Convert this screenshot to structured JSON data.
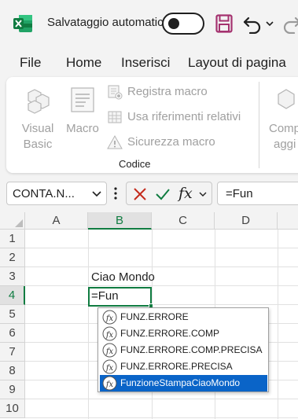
{
  "titlebar": {
    "autosave_label": "Salvataggio automatico",
    "autosave_on": false,
    "app_color": "#107c41",
    "save_color": "#a4326f"
  },
  "tabs": [
    "File",
    "Home",
    "Inserisci",
    "Layout di pagina"
  ],
  "ribbon": {
    "visual_basic": [
      "Visual",
      "Basic"
    ],
    "macro": "Macro",
    "record_macro": "Registra macro",
    "relative_refs": "Usa riferimenti relativi",
    "macro_security": "Sicurezza macro",
    "group_label": "Codice",
    "next_button": [
      "Comp",
      "aggi"
    ]
  },
  "formula_bar": {
    "name_box": "CONTA.N...",
    "fx": "fx",
    "formula": "=Fun"
  },
  "grid": {
    "columns": [
      "A",
      "B",
      "C",
      "D"
    ],
    "rows": [
      "1",
      "2",
      "3",
      "4",
      "5",
      "6",
      "7",
      "8",
      "9",
      "10"
    ],
    "active_column": "B",
    "active_row": "4",
    "cells": {
      "B3": "Ciao Mondo",
      "B4": "=Fun"
    }
  },
  "autocomplete": {
    "items": [
      "FUNZ.ERRORE",
      "FUNZ.ERRORE.COMP",
      "FUNZ.ERRORE.COMP.PRECISA",
      "FUNZ.ERRORE.PRECISA",
      "FunzioneStampaCiaoMondo"
    ],
    "selected_index": 4
  }
}
